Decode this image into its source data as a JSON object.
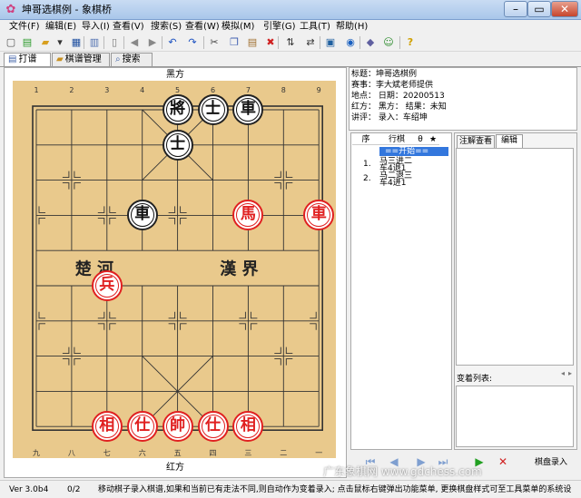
{
  "window": {
    "title": "坤哥选棋例 - 象棋桥",
    "minimize": "–",
    "maximize": "▭",
    "close": "✕",
    "app_icon": "flower-icon"
  },
  "menu": [
    "文件(F)",
    "编辑(E)",
    "导入(I)",
    "查看(V)",
    "搜索(S)",
    "查看(W)",
    "模拟(M)",
    "引擎(G)",
    "工具(T)",
    "帮助(H)"
  ],
  "toolbar": [
    {
      "name": "new-icon",
      "glyph": "▢"
    },
    {
      "name": "save-green-icon",
      "glyph": "▤"
    },
    {
      "name": "open-folder-icon",
      "glyph": "▰"
    },
    {
      "name": "dropdown-icon",
      "glyph": "▾"
    },
    {
      "name": "disk-icon",
      "glyph": "▦"
    },
    {
      "name": "book-icon",
      "glyph": "▥"
    },
    {
      "name": "trash-icon",
      "glyph": "▯"
    },
    {
      "name": "back-icon",
      "glyph": "◀"
    },
    {
      "name": "forward-icon",
      "glyph": "▶"
    },
    {
      "name": "undo-icon",
      "glyph": "↶"
    },
    {
      "name": "redo-icon",
      "glyph": "↷"
    },
    {
      "name": "cut-icon",
      "glyph": "✂"
    },
    {
      "name": "copy-icon",
      "glyph": "❐"
    },
    {
      "name": "paste-icon",
      "glyph": "▤"
    },
    {
      "name": "delete-icon",
      "glyph": "✖"
    },
    {
      "name": "swap-vertical-icon",
      "glyph": "⇅"
    },
    {
      "name": "swap-horizontal-icon",
      "glyph": "⇄"
    },
    {
      "name": "board-icon",
      "glyph": "▣"
    },
    {
      "name": "play-circle-icon",
      "glyph": "◉"
    },
    {
      "name": "tag-icon",
      "glyph": "◆"
    },
    {
      "name": "users-icon",
      "glyph": "☺"
    },
    {
      "name": "help-icon",
      "glyph": "?"
    }
  ],
  "tabs": [
    {
      "label": "打谱",
      "icon": "doc-icon",
      "active": true
    },
    {
      "label": "棋谱管理",
      "icon": "folder-icon",
      "active": false
    },
    {
      "label": "搜索",
      "icon": "magnifier-icon",
      "active": false
    }
  ],
  "board": {
    "top_label": "黑方",
    "bottom_label": "红方",
    "top_numbers": [
      "1",
      "2",
      "3",
      "4",
      "5",
      "6",
      "7",
      "8",
      "9"
    ],
    "bottom_numbers": [
      "九",
      "八",
      "七",
      "六",
      "五",
      "四",
      "三",
      "二",
      "一"
    ],
    "river_left": "楚  河",
    "river_right": "漢  界",
    "pieces": [
      {
        "char": "將",
        "side": "black",
        "file": 4,
        "rank": 0
      },
      {
        "char": "士",
        "side": "black",
        "file": 5,
        "rank": 0
      },
      {
        "char": "車",
        "side": "black",
        "file": 6,
        "rank": 0
      },
      {
        "char": "士",
        "side": "black",
        "file": 4,
        "rank": 1
      },
      {
        "char": "車",
        "side": "black",
        "file": 3,
        "rank": 3
      },
      {
        "char": "馬",
        "side": "red",
        "file": 6,
        "rank": 3
      },
      {
        "char": "車",
        "side": "red",
        "file": 8,
        "rank": 3
      },
      {
        "char": "兵",
        "side": "red",
        "file": 2,
        "rank": 5
      },
      {
        "char": "相",
        "side": "red",
        "file": 2,
        "rank": 9
      },
      {
        "char": "仕",
        "side": "red",
        "file": 3,
        "rank": 9
      },
      {
        "char": "帥",
        "side": "red",
        "file": 4,
        "rank": 9
      },
      {
        "char": "仕",
        "side": "red",
        "file": 5,
        "rank": 9
      },
      {
        "char": "相",
        "side": "red",
        "file": 6,
        "rank": 9
      }
    ]
  },
  "info": [
    "标题：坤哥选棋例",
    "赛事：李大斌老师提供",
    "地点：    日期：20200513",
    "红方：    黑方：    结果：未知",
    "讲评：    录入：车绍坤"
  ],
  "moves": {
    "headers": [
      "序",
      "行棋",
      "θ",
      "★"
    ],
    "start": "==开始==",
    "rows": [
      {
        "num": "1.",
        "red": "马三进二",
        "black": "车4退1"
      },
      {
        "num": "2.",
        "red": "马二退三",
        "black": "车4进1"
      }
    ]
  },
  "right": {
    "tabs": [
      "注解查看",
      "编辑"
    ],
    "variation_label": "变着列表:"
  },
  "nav": {
    "buttons": [
      "first-icon",
      "prev-icon",
      "next-icon",
      "last-icon",
      "play-icon",
      "stop-icon"
    ],
    "record_label": "棋盘录入"
  },
  "status": {
    "version": "Ver 3.0b4",
    "count": "0/2",
    "message": "移动棋子录入棋谱,如果和当前已有走法不同,则自动作为变着录入; 点击鼠标右键弹出功能菜单, 更换棋盘样式可至工具菜单的系统设"
  },
  "watermark": "广东象棋网 www.gdchess.com",
  "colors": {
    "board": "#e9c98c",
    "red": "#e02020",
    "black": "#222222"
  }
}
